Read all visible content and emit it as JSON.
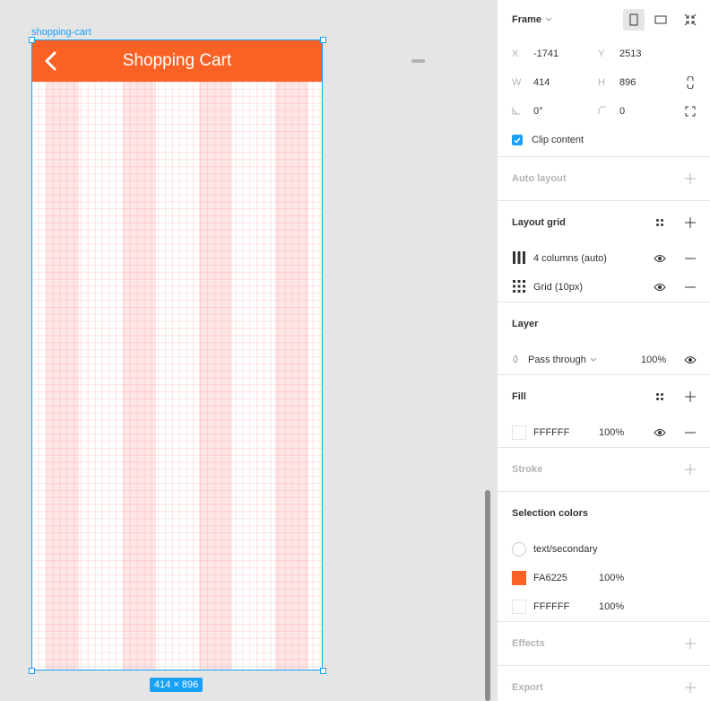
{
  "canvas": {
    "frame_name": "shopping-cart",
    "size_label": "414 × 896",
    "app_bar_title": "Shopping Cart",
    "colors": {
      "app_bar": "#FA6225",
      "selection": "#18A0FB"
    }
  },
  "panel": {
    "frame": {
      "title": "Frame",
      "x_label": "X",
      "x_value": "-1741",
      "y_label": "Y",
      "y_value": "2513",
      "w_label": "W",
      "w_value": "414",
      "h_label": "H",
      "h_value": "896",
      "rotation": "0°",
      "radius": "0",
      "clip_label": "Clip content",
      "clip_checked": true
    },
    "auto_layout": {
      "title": "Auto layout"
    },
    "layout_grid": {
      "title": "Layout grid",
      "items": [
        {
          "label": "4 columns (auto)",
          "icon": "columns-icon"
        },
        {
          "label": "Grid (10px)",
          "icon": "grid-icon"
        }
      ]
    },
    "layer": {
      "title": "Layer",
      "blend": "Pass through",
      "opacity": "100%"
    },
    "fill": {
      "title": "Fill",
      "hex": "FFFFFF",
      "opacity": "100%"
    },
    "stroke": {
      "title": "Stroke"
    },
    "selection_colors": {
      "title": "Selection colors",
      "items": [
        {
          "name": "text/secondary",
          "swatch": "#FFFFFF"
        },
        {
          "name": "FA6225",
          "opacity": "100%",
          "swatch": "#FA6225"
        },
        {
          "name": "FFFFFF",
          "opacity": "100%",
          "swatch": "#FFFFFF"
        }
      ]
    },
    "effects": {
      "title": "Effects"
    },
    "export": {
      "title": "Export"
    }
  }
}
